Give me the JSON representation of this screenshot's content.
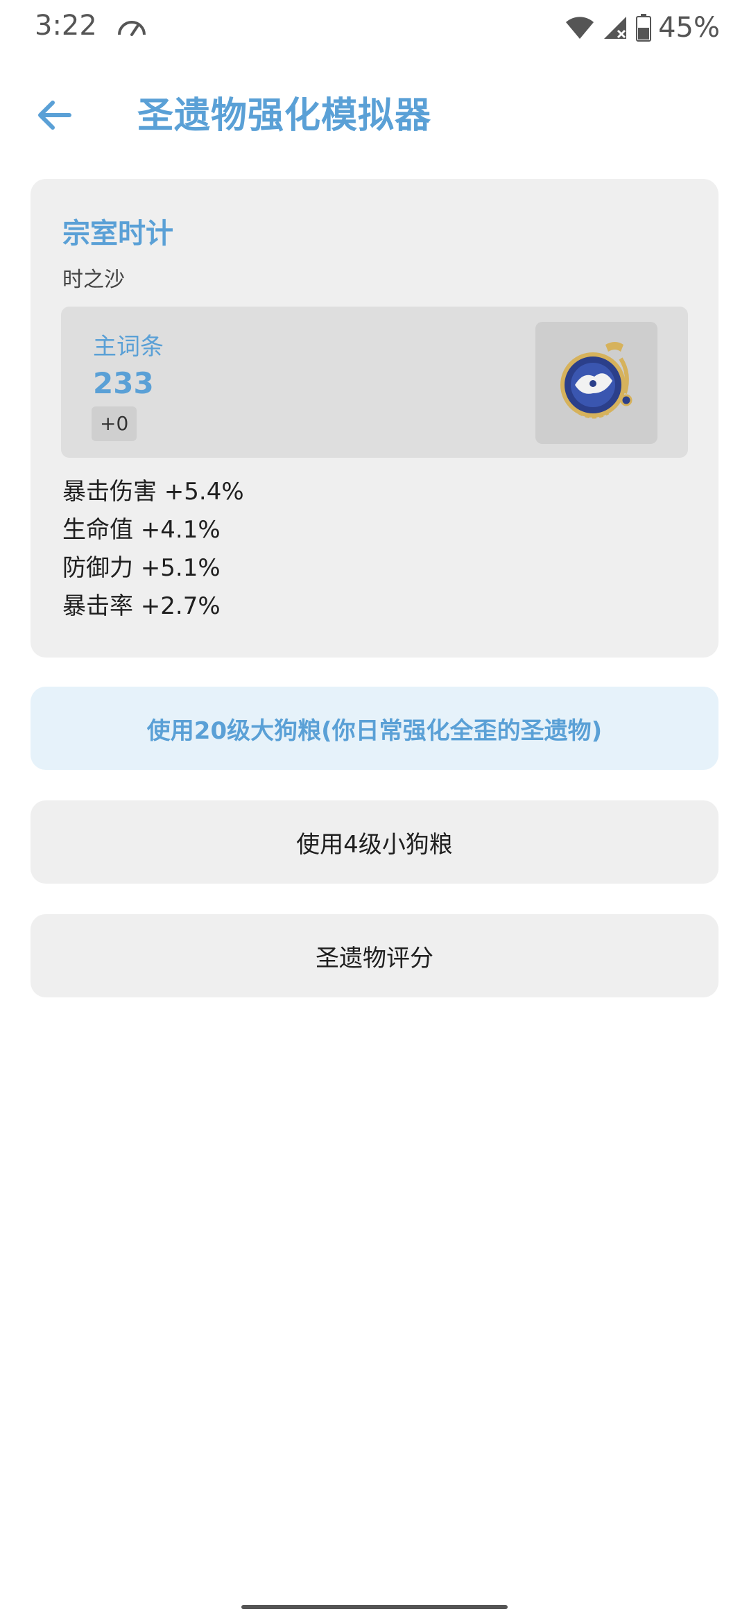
{
  "status_bar": {
    "time": "3:22",
    "battery_percent": "45%",
    "icons": [
      "speedometer-icon",
      "wifi-icon",
      "cell-signal-icon",
      "battery-icon"
    ]
  },
  "app_bar": {
    "back_icon": "arrow-left-icon",
    "title": "圣遗物强化模拟器"
  },
  "artifact": {
    "name": "宗室时计",
    "slot": "时之沙",
    "main_stat_label": "主词条",
    "main_stat_value": "233",
    "level": "+0",
    "image_icon": "pocket-watch-icon",
    "substats": [
      {
        "text": "暴击伤害 +5.4%"
      },
      {
        "text": "生命值 +4.1%"
      },
      {
        "text": "防御力 +5.1%"
      },
      {
        "text": "暴击率 +2.7%"
      }
    ]
  },
  "actions": {
    "large_fodder_label": "使用20级大狗粮(你日常强化全歪的圣遗物)",
    "small_fodder_label": "使用4级小狗粮",
    "score_label": "圣遗物评分"
  },
  "colors": {
    "accent": "#5aa0d6",
    "card_bg": "#efefef",
    "highlight_button_bg": "#e6f2fa"
  }
}
